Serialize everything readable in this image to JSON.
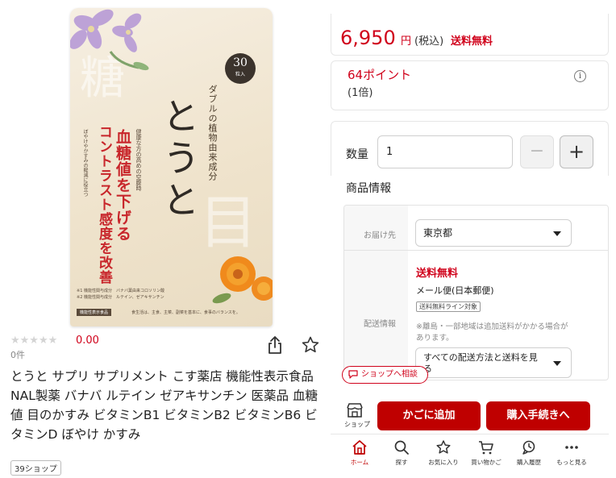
{
  "product": {
    "image": {
      "badge_count": "30",
      "badge_unit": "粒入",
      "kanji_left": "糖",
      "kanji_right": "目",
      "text_double": "ダブルの植物由来成分",
      "text_main": "とうと",
      "text_red1": "血糖値を下げる",
      "text_red2": "コントラスト感度を改善",
      "text_small1": "健康な方の高めの空腹時",
      "text_small2": "ぼやけやかすみの軽減に役立つ",
      "footnote1": "※1 機能性関与成分　バナバ葉由来コロソリン酸",
      "footnote2": "※2 機能性関与成分　ルテイン、ゼアキサンチン",
      "func_label": "機能性表示食品",
      "caution": "食生活は、主食、主菜、副菜を基本に、食事のバランスを。"
    },
    "stars": "★★★★★",
    "rating": "0.00",
    "reviews": "0件",
    "title": "とうと サプリ サプリメント こす薬店 機能性表示食品 NAL製薬 バナバ ルテイン ゼアキサンチン 医薬品 血糖値 目のかすみ ビタミンB1 ビタミンB2 ビタミンB6 ビタミンD ぼやけ かすみ",
    "shop_tag": "39ショップ"
  },
  "purchase": {
    "price": "6,950",
    "yen": "円",
    "tax": "(税込)",
    "free_shipping": "送料無料",
    "points": "64ポイント",
    "multiplier": "(1倍)",
    "info_icon": "i",
    "qty_label": "数量",
    "qty_value": "1",
    "minus": "−",
    "plus": "+",
    "info_heading": "商品情報",
    "dest_label": "お届け先",
    "prefecture": "東京都",
    "ship_label": "配送情報",
    "ship_free": "送料無料",
    "mail_method": "メール便(日本郵便)",
    "ship_tag": "送料無料ライン対象",
    "ship_note": "※離島・一部地域は追加送料がかかる場合があります。",
    "method_select": "すべての配送方法と送料を見る",
    "consult": "ショップへ相談",
    "shop_label": "ショップ",
    "add_to_cart": "かごに追加",
    "checkout": "購入手続きへ"
  },
  "nav": [
    {
      "label": "ホーム",
      "icon": "home-icon"
    },
    {
      "label": "探す",
      "icon": "search-icon"
    },
    {
      "label": "お気に入り",
      "icon": "star-icon"
    },
    {
      "label": "買い物かご",
      "icon": "cart-icon"
    },
    {
      "label": "購入履歴",
      "icon": "history-icon"
    },
    {
      "label": "もっと見る",
      "icon": "more-icon"
    }
  ],
  "colors": {
    "accent": "#bf0000",
    "price_red": "#d0021b"
  }
}
